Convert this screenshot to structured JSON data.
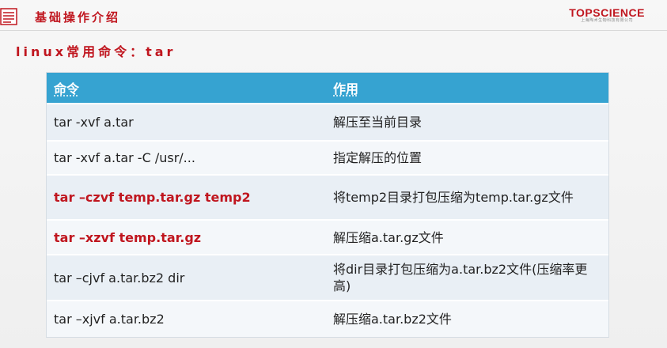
{
  "header": {
    "title": "基础操作介绍"
  },
  "logo": {
    "name": "TOPSCIENCE",
    "subtitle": "上海陶术生物科技有限公司"
  },
  "subtitle": "linux常用命令：tar",
  "table": {
    "columns": [
      "命令",
      "作用"
    ],
    "rows": [
      {
        "command": "tar -xvf a.tar",
        "description": "解压至当前目录",
        "highlight": false
      },
      {
        "command": "tar -xvf a.tar -C /usr/...",
        "description": "指定解压的位置",
        "highlight": false
      },
      {
        "command": "tar –czvf temp.tar.gz temp2",
        "description": "将temp2目录打包压缩为temp.tar.gz文件",
        "highlight": true
      },
      {
        "command": "tar –xzvf temp.tar.gz",
        "description": "解压缩a.tar.gz文件",
        "highlight": true
      },
      {
        "command": "tar –cjvf a.tar.bz2 dir",
        "description": "将dir目录打包压缩为a.tar.bz2文件(压缩率更高)",
        "highlight": false
      },
      {
        "command": "tar –xjvf a.tar.bz2",
        "description": "解压缩a.tar.bz2文件",
        "highlight": false
      }
    ]
  },
  "colors": {
    "accent_red": "#c0161f",
    "header_blue": "#36a3d1",
    "row_light": "#e9eff5"
  }
}
